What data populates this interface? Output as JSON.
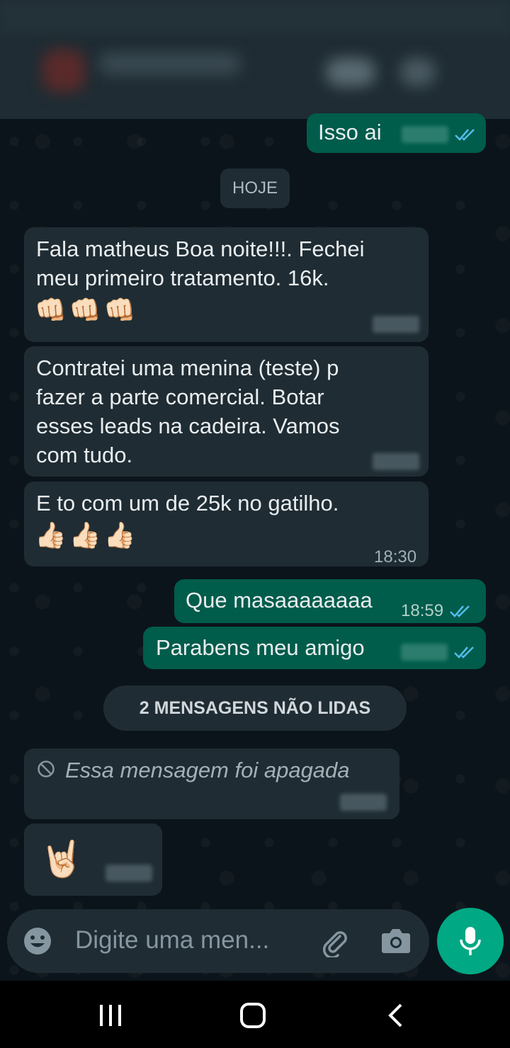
{
  "chat": {
    "date_separator": "HOJE",
    "unread_banner": "2 MENSAGENS NÃO LIDAS",
    "messages": [
      {
        "direction": "outgoing",
        "text": "Isso ai",
        "time": ""
      },
      {
        "direction": "incoming",
        "text_line1": "Fala matheus Boa noite!!!. Fechei",
        "text_line2": "meu primeiro tratamento. 16k.",
        "emoji": "👊🏻👊🏻👊🏻",
        "time": ""
      },
      {
        "direction": "incoming",
        "text_line1": "Contratei uma menina (teste) p",
        "text_line2": "fazer a parte comercial. Botar",
        "text_line3": "esses leads na cadeira. Vamos",
        "text_line4": "com tudo.",
        "time": ""
      },
      {
        "direction": "incoming",
        "text_line1": "E  to com um de 25k no gatilho.",
        "emoji": "👍🏻👍🏻👍🏻",
        "time": "18:30"
      },
      {
        "direction": "outgoing",
        "text": "Que masaaaaaaaa",
        "time": "18:59"
      },
      {
        "direction": "outgoing",
        "text": "Parabens meu amigo",
        "time": ""
      },
      {
        "direction": "incoming",
        "text": "Essa mensagem foi apagada",
        "deleted": true,
        "time": ""
      },
      {
        "direction": "incoming",
        "emoji": "🤘🏻",
        "time": ""
      }
    ]
  },
  "composer": {
    "placeholder": "Digite uma men..."
  },
  "colors": {
    "background": "#0b141a",
    "incoming_bubble": "#1f2c33",
    "outgoing_bubble": "#005c4b",
    "accent": "#00a884",
    "read_ticks": "#53bdeb"
  },
  "icons": [
    "emoji-icon",
    "attach-icon",
    "camera-icon",
    "mic-icon",
    "recents-icon",
    "home-icon",
    "back-icon",
    "blocked-icon",
    "double-check-icon"
  ]
}
